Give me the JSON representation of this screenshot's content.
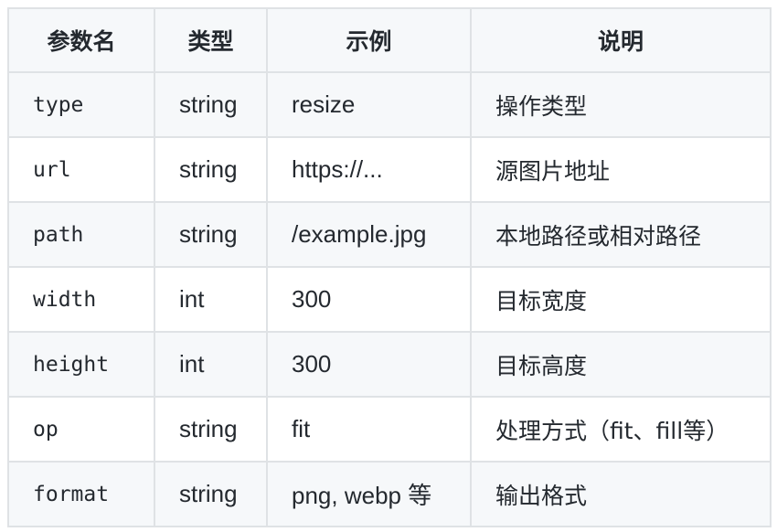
{
  "table": {
    "headers": [
      "参数名",
      "类型",
      "示例",
      "说明"
    ],
    "rows": [
      {
        "name": "type",
        "type": "string",
        "example": "resize",
        "description": "操作类型"
      },
      {
        "name": "url",
        "type": "string",
        "example": "https://...",
        "description": "源图片地址"
      },
      {
        "name": "path",
        "type": "string",
        "example": "/example.jpg",
        "description": "本地路径或相对路径"
      },
      {
        "name": "width",
        "type": "int",
        "example": "300",
        "description": "目标宽度"
      },
      {
        "name": "height",
        "type": "int",
        "example": "300",
        "description": "目标高度"
      },
      {
        "name": "op",
        "type": "string",
        "example": "fit",
        "description": "处理方式（fit、fill等）"
      },
      {
        "name": "format",
        "type": "string",
        "example": "png, webp 等",
        "description": "输出格式"
      }
    ]
  }
}
